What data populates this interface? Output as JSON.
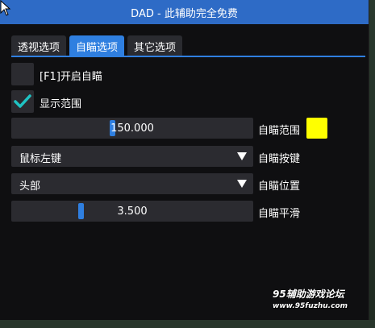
{
  "window": {
    "title": "DAD - 此辅助完全免费"
  },
  "tabs": [
    {
      "label": "透视选项",
      "active": false
    },
    {
      "label": "自瞄选项",
      "active": true
    },
    {
      "label": "其它选项",
      "active": false
    }
  ],
  "controls": {
    "enable_aimbot": {
      "label": "[F1]开启自瞄",
      "checked": false
    },
    "show_range": {
      "label": "显示范围",
      "checked": true
    },
    "aim_range": {
      "value": "150.000",
      "label": "自瞄范围",
      "color": "#ffff00"
    },
    "aim_key": {
      "value": "鼠标左键",
      "label": "自瞄按键"
    },
    "aim_position": {
      "value": "头部",
      "label": "自瞄位置"
    },
    "aim_smooth": {
      "value": "3.500",
      "label": "自瞄平滑"
    }
  },
  "watermark": {
    "line1": "95辅助游戏论坛",
    "line2": "www.95fuzhu.com"
  },
  "colors": {
    "accent": "#2f7fe0",
    "title_bar": "#2e6bc6",
    "check": "#1fc3c3"
  }
}
